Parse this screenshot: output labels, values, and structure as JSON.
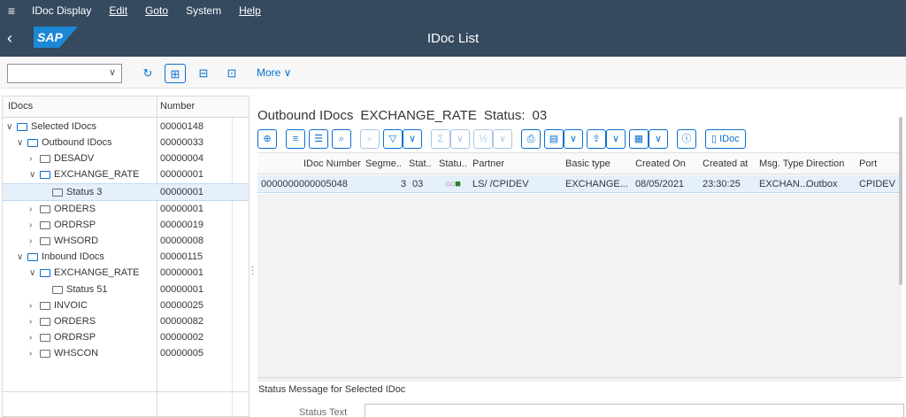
{
  "menubar": {
    "items": [
      {
        "label": "IDoc Display"
      },
      {
        "label": "Edit"
      },
      {
        "label": "Goto"
      },
      {
        "label": "System"
      },
      {
        "label": "Help"
      }
    ],
    "system_id": "RSEIDOC2"
  },
  "titlebar": {
    "logo": "SAP",
    "title": "IDoc List"
  },
  "toolbar": {
    "more_label": "More ∨"
  },
  "tree": {
    "col_idocs": "IDocs",
    "col_number": "Number",
    "rows": [
      {
        "label": "Selected IDocs",
        "number": "00000148",
        "level": 0,
        "expanded": true
      },
      {
        "label": "Outbound IDocs",
        "number": "00000033",
        "level": 1,
        "expanded": true
      },
      {
        "label": "DESADV",
        "number": "00000004",
        "level": 2,
        "expanded": false
      },
      {
        "label": "EXCHANGE_RATE",
        "number": "00000001",
        "level": 2,
        "expanded": true
      },
      {
        "label": "Status 3",
        "number": "00000001",
        "level": 3,
        "selected": true
      },
      {
        "label": "ORDERS",
        "number": "00000001",
        "level": 2,
        "expanded": false
      },
      {
        "label": "ORDRSP",
        "number": "00000019",
        "level": 2,
        "expanded": false
      },
      {
        "label": "WHSORD",
        "number": "00000008",
        "level": 2,
        "expanded": false
      },
      {
        "label": "Inbound IDocs",
        "number": "00000115",
        "level": 1,
        "expanded": true
      },
      {
        "label": "EXCHANGE_RATE",
        "number": "00000001",
        "level": 2,
        "expanded": true
      },
      {
        "label": "Status 51",
        "number": "00000001",
        "level": 3
      },
      {
        "label": "INVOIC",
        "number": "00000025",
        "level": 2,
        "expanded": false
      },
      {
        "label": "ORDERS",
        "number": "00000082",
        "level": 2,
        "expanded": false
      },
      {
        "label": "ORDRSP",
        "number": "00000002",
        "level": 2,
        "expanded": false
      },
      {
        "label": "WHSCON",
        "number": "00000005",
        "level": 2,
        "expanded": false
      }
    ]
  },
  "panel": {
    "heading_direction": "Outbound IDocs",
    "heading_basic": "EXCHANGE_RATE",
    "heading_status": "Status:",
    "heading_status_val": "03",
    "idoc_btn_label": "IDoc"
  },
  "grid": {
    "columns": [
      "IDoc Number",
      "Segme..",
      "Stat..",
      "Statu..",
      "Partner",
      "Basic type",
      "Created On",
      "Created at",
      "Msg. Type",
      "Direction",
      "Port"
    ],
    "rows": [
      {
        "idoc_number": "0000000000005048",
        "segments": "3",
        "status": "03",
        "partner": "LS/ /CPIDEV",
        "basic_type": "EXCHANGE...",
        "created_on": "08/05/2021",
        "created_at": "23:30:25",
        "msg_type": "EXCHAN...",
        "direction": "Outbox",
        "port": "CPIDEV"
      }
    ]
  },
  "status_section": {
    "title": "Status Message for Selected IDoc",
    "status_text_label": "Status Text"
  }
}
